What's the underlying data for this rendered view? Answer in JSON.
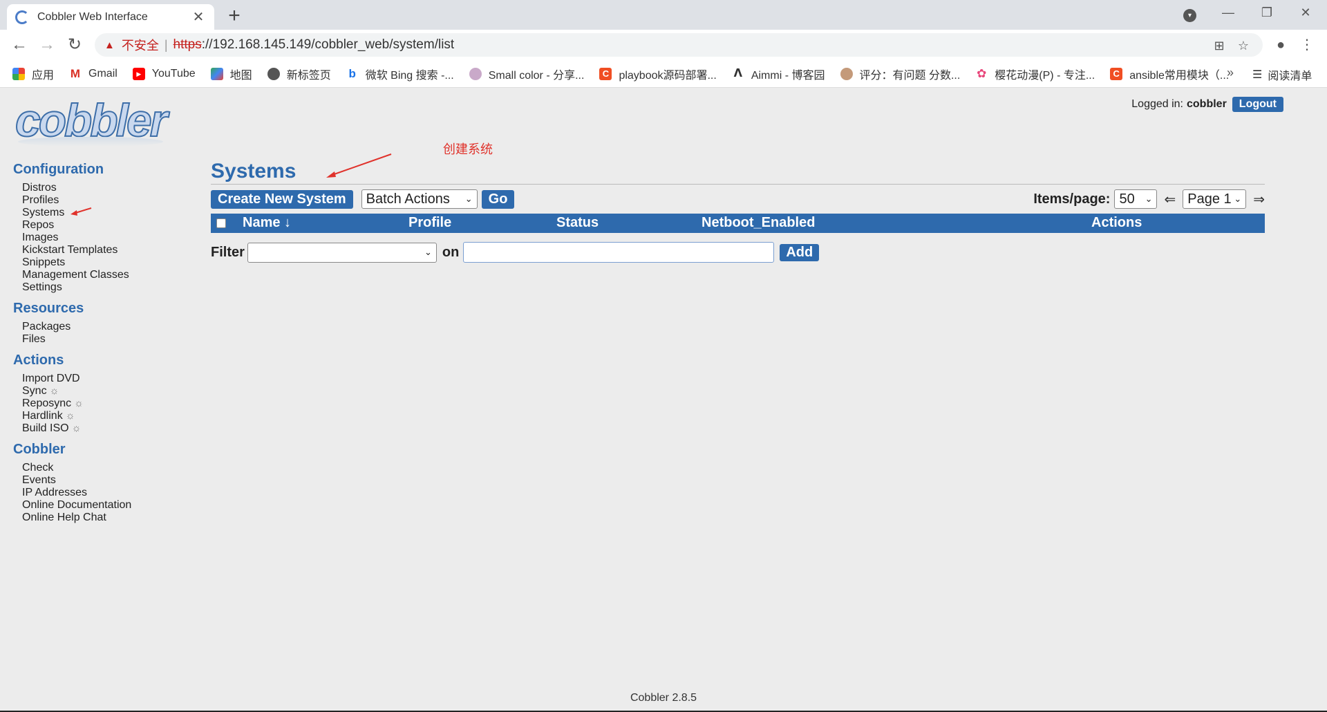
{
  "browser": {
    "tab_title": "Cobbler Web Interface",
    "insecure_label": "不安全",
    "url_scheme": "https",
    "url_rest": "://192.168.145.149/cobbler_web/system/list",
    "bookmarks": [
      {
        "label": "应用",
        "icon": "apps-grid-icon"
      },
      {
        "label": "Gmail",
        "icon": "gmail-icon"
      },
      {
        "label": "YouTube",
        "icon": "youtube-icon"
      },
      {
        "label": "地图",
        "icon": "maps-icon"
      },
      {
        "label": "新标签页",
        "icon": "globe-icon"
      },
      {
        "label": "微软 Bing 搜索 -...",
        "icon": "bing-icon"
      },
      {
        "label": "Small color - 分享...",
        "icon": "smallcolor-icon"
      },
      {
        "label": "playbook源码部署...",
        "icon": "csdn-icon"
      },
      {
        "label": "Aimmi - 博客园",
        "icon": "cnblogs-icon"
      },
      {
        "label": "评分：有问题 分数...",
        "icon": "avatar-icon"
      },
      {
        "label": "樱花动漫(P) - 专注...",
        "icon": "sakura-icon"
      },
      {
        "label": "ansible常用模块（...",
        "icon": "csdn-icon"
      }
    ],
    "more_label": "»",
    "reading_list_label": "阅读清单"
  },
  "header": {
    "logo_text": "cobbler",
    "logged_in_label": "Logged in:",
    "username": "cobbler",
    "logout_label": "Logout"
  },
  "sidebar": {
    "configuration": {
      "heading": "Configuration",
      "items": [
        "Distros",
        "Profiles",
        "Systems",
        "Repos",
        "Images",
        "Kickstart Templates",
        "Snippets",
        "Management Classes",
        "Settings"
      ]
    },
    "resources": {
      "heading": "Resources",
      "items": [
        "Packages",
        "Files"
      ]
    },
    "actions": {
      "heading": "Actions",
      "items": [
        "Import DVD",
        "Sync",
        "Reposync",
        "Hardlink",
        "Build ISO"
      ]
    },
    "cobbler": {
      "heading": "Cobbler",
      "items": [
        "Check",
        "Events",
        "IP Addresses",
        "Online Documentation",
        "Online Help Chat"
      ]
    }
  },
  "main": {
    "title": "Systems",
    "create_label": "Create New System",
    "batch_actions_value": "Batch Actions",
    "go_label": "Go",
    "items_per_page_label": "Items/page:",
    "items_per_page_value": "50",
    "prev_arrow": "⇐",
    "page_value": "Page 1",
    "next_arrow": "⇒",
    "columns": [
      "Name ↓",
      "Profile",
      "Status",
      "Netboot_Enabled",
      "Actions"
    ],
    "filter_label": "Filter",
    "on_label": "on",
    "add_label": "Add"
  },
  "annotation": {
    "text": "创建系统"
  },
  "footer": {
    "version": "Cobbler 2.8.5"
  },
  "colors": {
    "accent": "#2e6aad",
    "annotation": "#e0322b",
    "background": "#ececec"
  }
}
